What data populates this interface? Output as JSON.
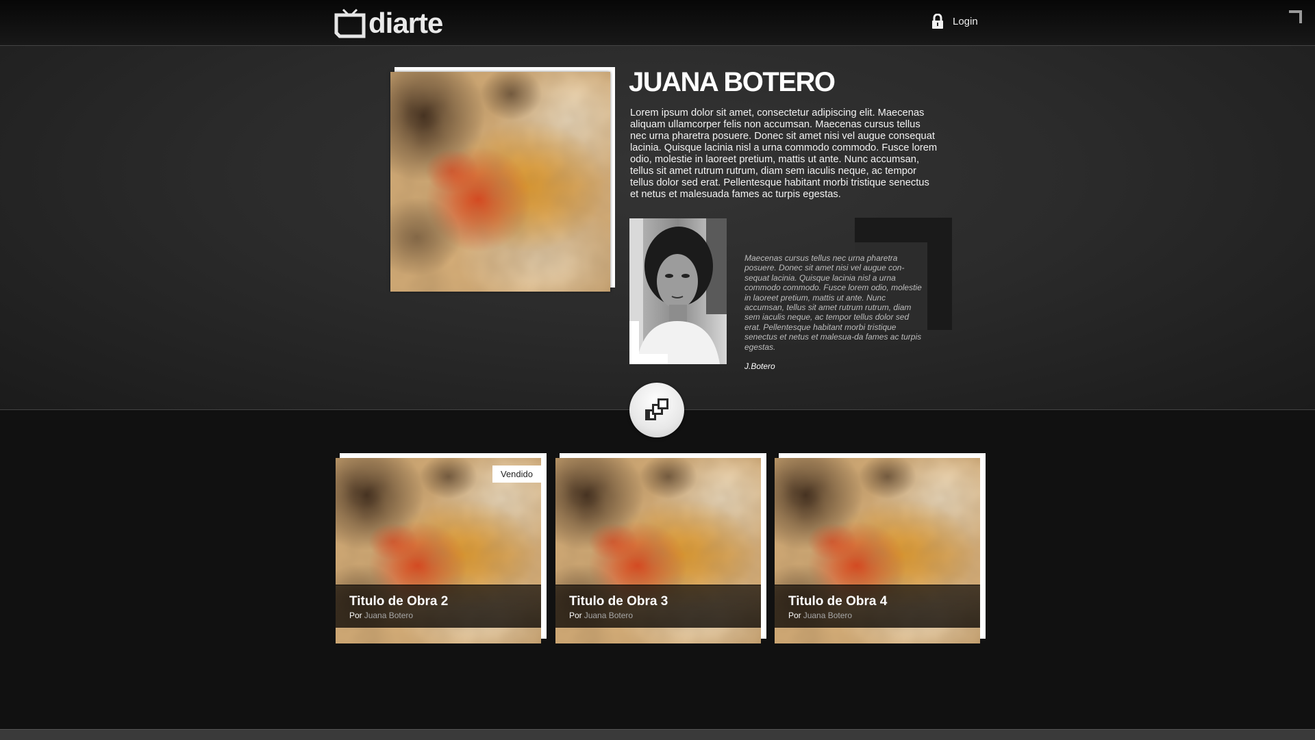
{
  "header": {
    "logo_text": "diarte",
    "login_label": "Login"
  },
  "artist": {
    "name": "JUANA BOTERO",
    "bio": "Lorem ipsum dolor sit amet, consectetur adipiscing elit. Maecenas aliquam ullamcorper felis non accumsan. Maecenas cursus tellus nec urna pharetra posuere. Donec sit amet nisi vel augue consequat lacinia. Quisque lacinia nisl a urna commodo commodo. Fusce lorem odio, molestie in laoreet pretium, mattis ut ante. Nunc accumsan, tellus sit amet rutrum rutrum, diam sem iaculis neque, ac tempor tellus dolor sed erat. Pellentesque habitant morbi tristique senectus et netus et malesuada fames ac turpis egestas.",
    "quote": "Maecenas cursus tellus nec urna pharetra posuere. Donec sit amet nisi vel augue con-sequat lacinia. Quisque lacinia nisl a urna commodo commodo. Fusce lorem odio, molestie in laoreet pretium, mattis ut ante. Nunc accumsan, tellus sit amet rutrum rutrum, diam sem iaculis neque, ac tempor tellus dolor sed erat. Pellentesque habitant morbi tristique senectus et netus et malesua-da fames ac turpis egestas.",
    "signature": "J.Botero"
  },
  "works": [
    {
      "title": "Titulo de Obra 2",
      "by_label": "Por",
      "artist": "Juana Botero",
      "badge": "Vendido"
    },
    {
      "title": "Titulo de Obra 3",
      "by_label": "Por",
      "artist": "Juana Botero"
    },
    {
      "title": "Titulo de Obra 4",
      "by_label": "Por",
      "artist": "Juana Botero"
    }
  ],
  "icons": {
    "logo": "tv-icon",
    "login": "lock-icon",
    "corner": "corner-bracket-icon",
    "gallery": "gallery-icon"
  },
  "colors": {
    "header_bg": "#0e0e0e",
    "hero_bg": "#2b2b2b",
    "page_bg": "#111111",
    "muted_text": "#a8a8a8"
  }
}
